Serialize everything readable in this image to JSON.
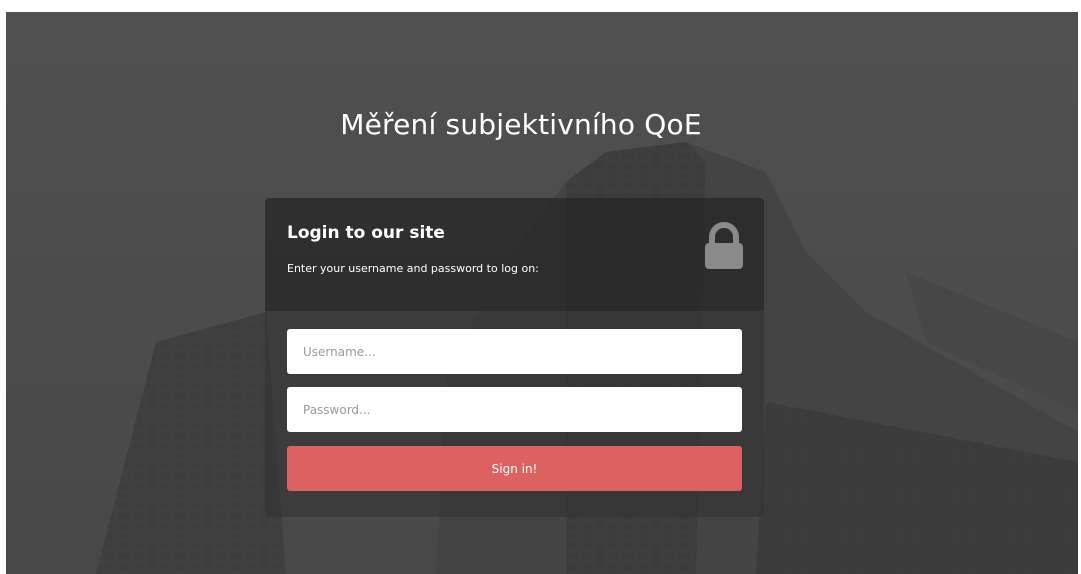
{
  "page": {
    "title": "Měření subjektivního QoE"
  },
  "login": {
    "title": "Login to our site",
    "subtitle": "Enter your username and password to log on:",
    "lock_icon": "lock-icon",
    "username": {
      "placeholder": "Username...",
      "value": ""
    },
    "password": {
      "placeholder": "Password...",
      "value": ""
    },
    "submit_label": "Sign in!"
  },
  "colors": {
    "accent": "#de6161",
    "background": "#4b4b4b",
    "card_header": "#262626",
    "text": "#ffffff",
    "lock": "#8a8a8a"
  }
}
